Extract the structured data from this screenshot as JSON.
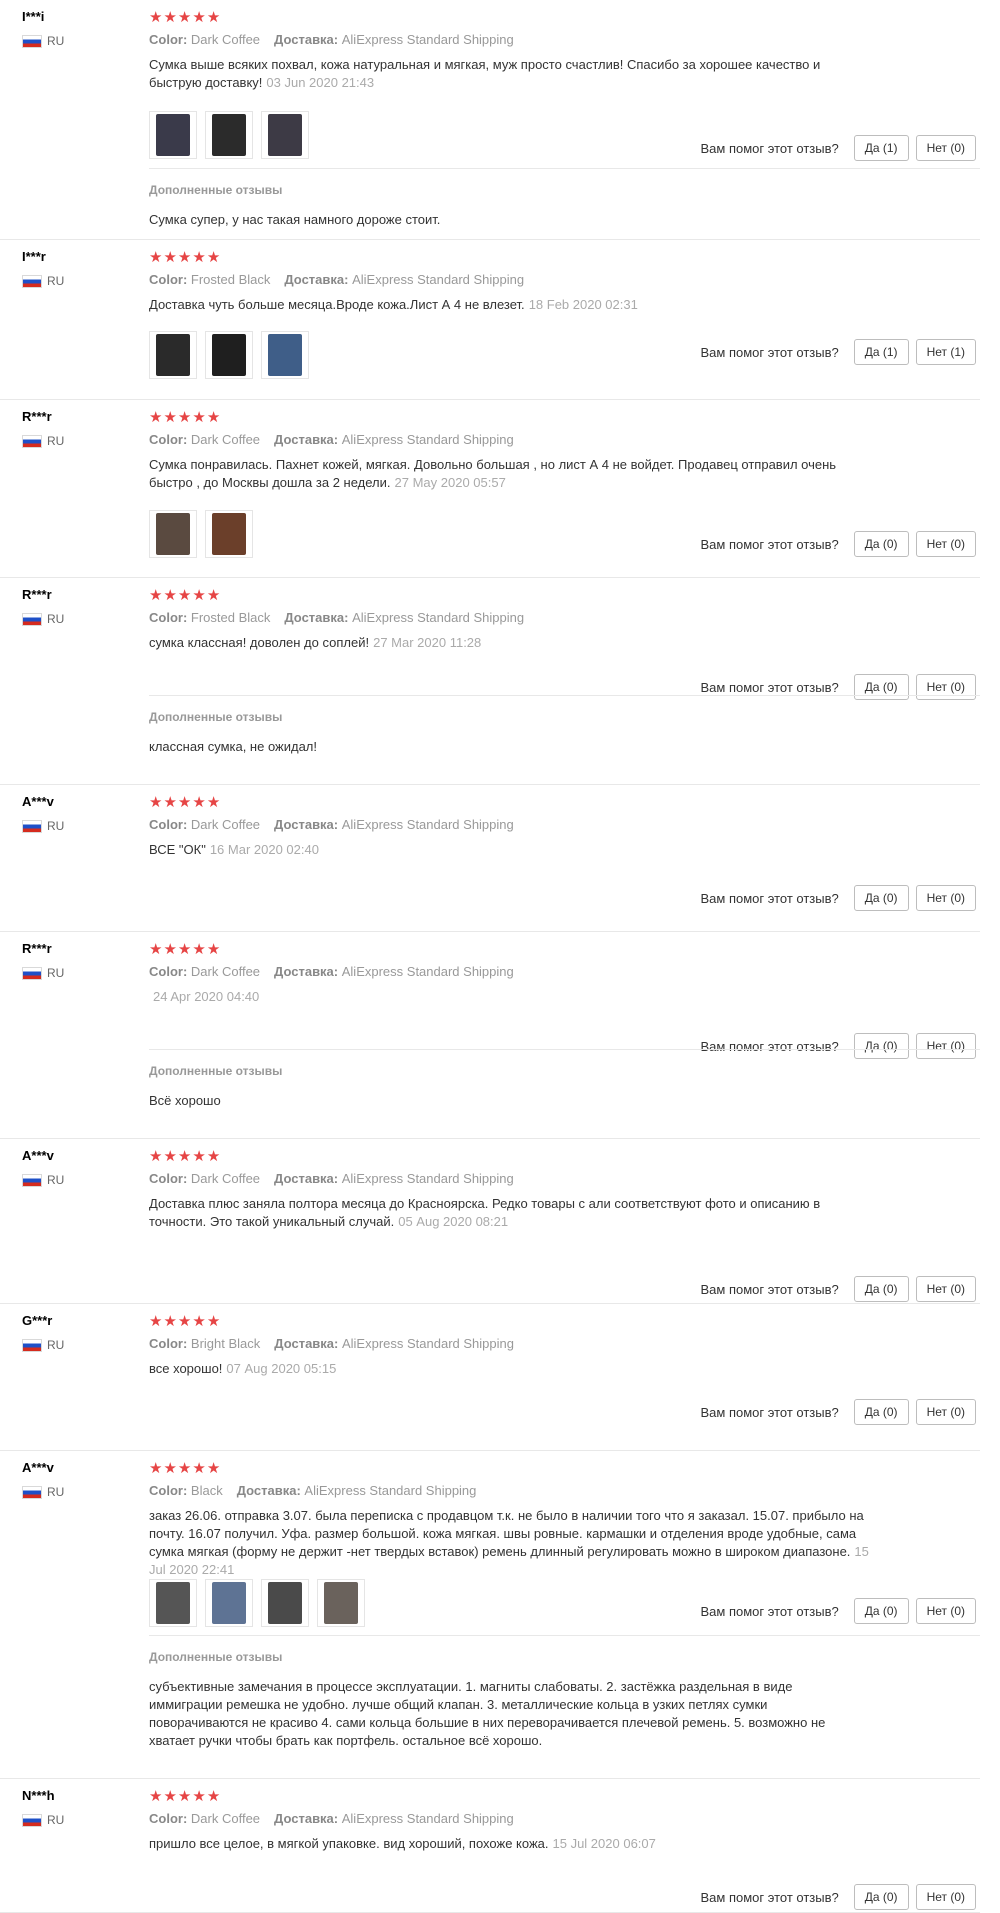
{
  "labels": {
    "color": "Color:",
    "shipping": "Доставка:",
    "helpful_question": "Вам помог этот отзыв?",
    "additional_reviews": "Дополненные отзывы",
    "star": "★"
  },
  "colors": {
    "star": "#e64545",
    "flag": [
      "#ffffff",
      "#1e50c8",
      "#d52b1e"
    ]
  },
  "reviews": [
    {
      "user": "I***i",
      "country": "RU",
      "stars": 5,
      "color": "Dark Coffee",
      "shipping": "AliExpress Standard Shipping",
      "text": "Сумка выше всяких похвал, кожа натуральная и мягкая, муж просто счастлив! Спасибо за хорошее качество и быструю доставку!",
      "date": "03 Jun 2020 21:43",
      "photos": [
        "#3a3a4a",
        "#2b2b2b",
        "#3d3a45"
      ],
      "yes": "Да (1)",
      "no": "Нет (0)",
      "additional": "Сумка супер, у нас такая намного дороже стоит."
    },
    {
      "user": "I***r",
      "country": "RU",
      "stars": 5,
      "color": "Frosted Black",
      "shipping": "AliExpress Standard Shipping",
      "text": "Доставка чуть больше месяца.Вроде кожа.Лист А 4 не влезет.",
      "date": "18 Feb 2020 02:31",
      "photos": [
        "#2a2a2a",
        "#1f1f1f",
        "#3f5e88"
      ],
      "yes": "Да (1)",
      "no": "Нет (1)",
      "additional": ""
    },
    {
      "user": "R***r",
      "country": "RU",
      "stars": 5,
      "color": "Dark Coffee",
      "shipping": "AliExpress Standard Shipping",
      "text": "Сумка понравилась. Пахнет кожей, мягкая. Довольно большая , но лист А 4 не войдет. Продавец отправил очень быстро , до Москвы дошла за 2 недели.",
      "date": "27 May 2020 05:57",
      "photos": [
        "#5a4a40",
        "#6b3f2a"
      ],
      "yes": "Да (0)",
      "no": "Нет (0)",
      "additional": ""
    },
    {
      "user": "R***r",
      "country": "RU",
      "stars": 5,
      "color": "Frosted Black",
      "shipping": "AliExpress Standard Shipping",
      "text": "сумка классная! доволен до соплей!",
      "date": "27 Mar 2020 11:28",
      "photos": [],
      "yes": "Да (0)",
      "no": "Нет (0)",
      "additional": "классная сумка, не ожидал!"
    },
    {
      "user": "A***v",
      "country": "RU",
      "stars": 5,
      "color": "Dark Coffee",
      "shipping": "AliExpress Standard Shipping",
      "text": "ВСЕ \"ОК\"",
      "date": "16 Mar 2020 02:40",
      "photos": [],
      "yes": "Да (0)",
      "no": "Нет (0)",
      "additional": ""
    },
    {
      "user": "R***r",
      "country": "RU",
      "stars": 5,
      "color": "Dark Coffee",
      "shipping": "AliExpress Standard Shipping",
      "text": "",
      "date": "24 Apr 2020 04:40",
      "photos": [],
      "yes": "Да (0)",
      "no": "Нет (0)",
      "additional": "Всё хорошо"
    },
    {
      "user": "A***v",
      "country": "RU",
      "stars": 5,
      "color": "Dark Coffee",
      "shipping": "AliExpress Standard Shipping",
      "text": "Доставка плюс заняла полтора месяца до Красноярска. Редко товары с али соответствуют фото и описанию в точности. Это такой уникальный случай.",
      "date": "05 Aug 2020 08:21",
      "photos": [],
      "yes": "Да (0)",
      "no": "Нет (0)",
      "additional": ""
    },
    {
      "user": "G***r",
      "country": "RU",
      "stars": 5,
      "color": "Bright Black",
      "shipping": "AliExpress Standard Shipping",
      "text": "все хорошо!",
      "date": "07 Aug 2020 05:15",
      "photos": [],
      "yes": "Да (0)",
      "no": "Нет (0)",
      "additional": ""
    },
    {
      "user": "A***v",
      "country": "RU",
      "stars": 5,
      "color": "Black",
      "shipping": "AliExpress Standard Shipping",
      "text": "заказ 26.06. отправка 3.07. была переписка с продавцом т.к. не было в наличии того что я заказал. 15.07. прибыло на почту. 16.07 получил. Уфа. размер большой. кожа мягкая. швы ровные. кармашки и отделения вроде удобные, сама сумка мягкая (форму не держит -нет твердых вставок) ремень длинный регулировать можно в широком диапазоне.",
      "date": "15 Jul 2020 22:41",
      "photos": [
        "#555555",
        "#5e7394",
        "#4a4a4a",
        "#6a625c"
      ],
      "yes": "Да (0)",
      "no": "Нет (0)",
      "additional": "субъективные замечания в процессе эксплуатации. 1. магниты слабоваты. 2. застёжка раздельная в виде иммиграции ремешка не удобно. лучше общий клапан. 3. металлические кольца в узких петлях сумки поворачиваются не красиво 4. сами кольца большие в них переворачивается плечевой ремень. 5. возможно не хватает ручки чтобы брать как портфель. остальное всё хорошо."
    },
    {
      "user": "N***h",
      "country": "RU",
      "stars": 5,
      "color": "Dark Coffee",
      "shipping": "AliExpress Standard Shipping",
      "text": "пришло все целое, в мягкой упаковке. вид хороший, похоже кожа.",
      "date": "15 Jul 2020 06:07",
      "photos": [],
      "yes": "Да (0)",
      "no": "Нет (0)",
      "additional": ""
    }
  ]
}
